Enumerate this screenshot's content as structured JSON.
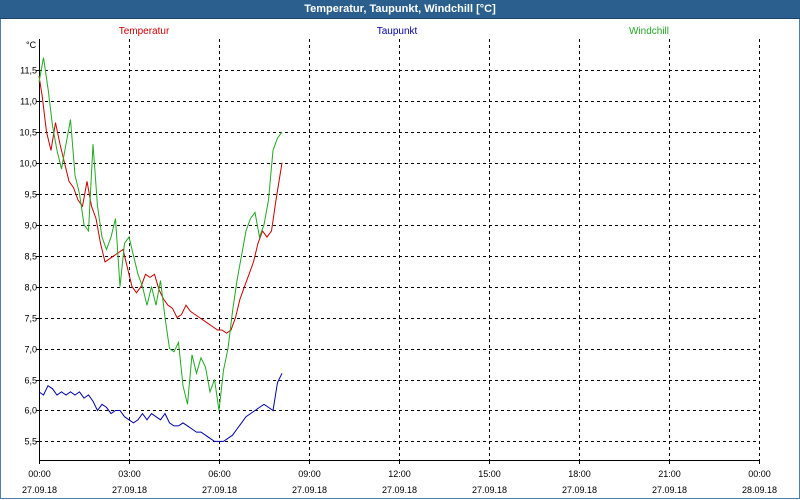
{
  "window": {
    "title": "Temperatur, Taupunkt, Windchill [°C]"
  },
  "chart_data": {
    "type": "line",
    "title": "Temperatur, Taupunkt, Windchill [°C]",
    "ylabel": "°C",
    "ylim": [
      5.2,
      12.0
    ],
    "yticks": [
      5.5,
      6.0,
      6.5,
      7.0,
      7.5,
      8.0,
      8.5,
      9.0,
      9.5,
      10.0,
      10.5,
      11.0,
      11.5
    ],
    "ytick_labels": [
      "5,5",
      "6,0",
      "6,5",
      "7,0",
      "7,5",
      "8,0",
      "8,5",
      "9,0",
      "9,5",
      "10,0",
      "10,5",
      "11,0",
      "11,5"
    ],
    "xlim": [
      0,
      24
    ],
    "xticks": [
      0,
      3,
      6,
      9,
      12,
      15,
      18,
      21,
      24
    ],
    "xtick_labels": [
      [
        "00:00",
        "27.09.18"
      ],
      [
        "03:00",
        "27.09.18"
      ],
      [
        "06:00",
        "27.09.18"
      ],
      [
        "09:00",
        "27.09.18"
      ],
      [
        "12:00",
        "27.09.18"
      ],
      [
        "15:00",
        "27.09.18"
      ],
      [
        "18:00",
        "27.09.18"
      ],
      [
        "21:00",
        "27.09.18"
      ],
      [
        "00:00",
        "28.09.18"
      ]
    ],
    "grid": true,
    "legend_position": "top",
    "series": [
      {
        "name": "Temperatur",
        "color": "#cc0000",
        "x": [
          0.0,
          0.1,
          0.25,
          0.4,
          0.55,
          0.7,
          0.85,
          1.0,
          1.15,
          1.3,
          1.45,
          1.6,
          1.75,
          1.9,
          2.05,
          2.2,
          2.35,
          2.5,
          2.65,
          2.8,
          2.95,
          3.1,
          3.25,
          3.4,
          3.55,
          3.7,
          3.85,
          4.0,
          4.15,
          4.3,
          4.45,
          4.6,
          4.75,
          4.9,
          5.05,
          5.2,
          5.35,
          5.5,
          5.65,
          5.8,
          5.95,
          6.1,
          6.25,
          6.4,
          6.55,
          6.7,
          6.85,
          7.0,
          7.15,
          7.3,
          7.45,
          7.6,
          7.75,
          7.9,
          8.1
        ],
        "y": [
          11.4,
          11.1,
          10.5,
          10.2,
          10.65,
          10.3,
          10.0,
          9.7,
          9.6,
          9.4,
          9.3,
          9.7,
          9.3,
          9.1,
          8.7,
          8.4,
          8.45,
          8.5,
          8.55,
          8.6,
          8.3,
          8.0,
          7.9,
          8.0,
          8.2,
          8.15,
          8.2,
          7.95,
          7.8,
          7.7,
          7.65,
          7.5,
          7.55,
          7.7,
          7.6,
          7.55,
          7.5,
          7.45,
          7.4,
          7.35,
          7.3,
          7.3,
          7.25,
          7.3,
          7.5,
          7.8,
          8.0,
          8.2,
          8.4,
          8.7,
          8.9,
          8.8,
          8.9,
          9.4,
          10.0
        ]
      },
      {
        "name": "Taupunkt",
        "color": "#0000aa",
        "x": [
          0.0,
          0.15,
          0.3,
          0.45,
          0.6,
          0.75,
          0.9,
          1.05,
          1.2,
          1.35,
          1.5,
          1.65,
          1.8,
          1.95,
          2.1,
          2.25,
          2.4,
          2.55,
          2.7,
          2.85,
          3.0,
          3.15,
          3.3,
          3.45,
          3.6,
          3.75,
          3.9,
          4.05,
          4.2,
          4.35,
          4.5,
          4.65,
          4.8,
          4.95,
          5.1,
          5.25,
          5.4,
          5.55,
          5.7,
          5.85,
          6.0,
          6.15,
          6.3,
          6.45,
          6.6,
          6.75,
          6.9,
          7.05,
          7.2,
          7.35,
          7.5,
          7.65,
          7.8,
          7.95,
          8.1
        ],
        "y": [
          6.3,
          6.25,
          6.4,
          6.35,
          6.25,
          6.3,
          6.25,
          6.3,
          6.25,
          6.3,
          6.2,
          6.25,
          6.15,
          6.0,
          6.1,
          6.05,
          5.95,
          6.0,
          6.0,
          5.9,
          5.85,
          5.8,
          5.85,
          5.95,
          5.85,
          5.95,
          5.9,
          5.85,
          5.95,
          5.8,
          5.75,
          5.75,
          5.8,
          5.75,
          5.7,
          5.65,
          5.65,
          5.6,
          5.55,
          5.5,
          5.5,
          5.5,
          5.55,
          5.6,
          5.7,
          5.8,
          5.9,
          5.95,
          6.0,
          6.05,
          6.1,
          6.05,
          6.0,
          6.45,
          6.6
        ]
      },
      {
        "name": "Windchill",
        "color": "#22aa22",
        "x": [
          0.0,
          0.15,
          0.3,
          0.45,
          0.6,
          0.75,
          0.9,
          1.05,
          1.2,
          1.35,
          1.5,
          1.65,
          1.8,
          1.95,
          2.1,
          2.25,
          2.4,
          2.55,
          2.7,
          2.85,
          3.0,
          3.15,
          3.3,
          3.45,
          3.6,
          3.75,
          3.9,
          4.05,
          4.2,
          4.35,
          4.5,
          4.65,
          4.8,
          4.95,
          5.1,
          5.25,
          5.4,
          5.55,
          5.7,
          5.85,
          6.0,
          6.15,
          6.3,
          6.45,
          6.6,
          6.75,
          6.9,
          7.05,
          7.2,
          7.35,
          7.5,
          7.65,
          7.8,
          7.95,
          8.1
        ],
        "y": [
          11.3,
          11.7,
          11.2,
          10.6,
          10.2,
          9.9,
          10.3,
          10.7,
          9.8,
          9.5,
          9.0,
          8.9,
          10.3,
          9.3,
          8.8,
          8.6,
          8.8,
          9.1,
          8.0,
          8.7,
          8.8,
          8.5,
          8.2,
          8.0,
          7.7,
          8.0,
          7.7,
          8.1,
          7.5,
          7.0,
          6.95,
          7.1,
          6.4,
          6.1,
          6.9,
          6.6,
          6.85,
          6.7,
          6.3,
          6.5,
          6.0,
          6.65,
          7.0,
          7.6,
          8.1,
          8.5,
          8.9,
          9.1,
          9.2,
          8.8,
          9.0,
          9.4,
          10.2,
          10.4,
          10.5
        ]
      }
    ]
  }
}
